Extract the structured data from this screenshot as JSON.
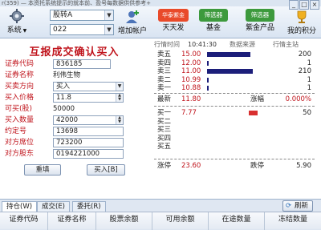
{
  "topbar": {
    "text": "r(359) — 本资托系统提示的就本前、盈号每数据供供参考+"
  },
  "toolbar": {
    "system_label": "系统",
    "stock_name": "股转A",
    "account": "022",
    "add_account_label": "增加帐户",
    "promo1_badge": "华泰紫金",
    "promo1_label": "天天发",
    "promo2_badge": "筛选器",
    "promo2_label": "基金",
    "promo3_badge": "筛选器",
    "promo3_label": "紫金产品",
    "points_label": "我的积分"
  },
  "form": {
    "title": "互报成交确认买入",
    "fields": [
      {
        "label": "证券代码",
        "value": "836185"
      },
      {
        "label": "证券名称",
        "value": "利伟生物"
      },
      {
        "label": "买卖方向",
        "value": "买入"
      },
      {
        "label": "买入价格",
        "value": "11.8"
      },
      {
        "label": "可买(股)",
        "value": "50000"
      },
      {
        "label": "买入数量",
        "value": "42000"
      },
      {
        "label": "约定号",
        "value": "13698"
      },
      {
        "label": "对方席位",
        "value": "723200"
      },
      {
        "label": "对方股东",
        "value": "0194221000"
      }
    ],
    "reset_label": "重填",
    "buy_label": "买入[B]"
  },
  "quote": {
    "time_label": "行情时间",
    "time_value": "10:41:30",
    "source_label": "数据来源",
    "source_value": "行情主站",
    "asks": [
      {
        "name": "卖五",
        "price": "15.00",
        "volume": "200",
        "bar": 0.9
      },
      {
        "name": "卖四",
        "price": "12.00",
        "volume": "1",
        "bar": 0.02
      },
      {
        "name": "卖三",
        "price": "11.00",
        "volume": "210",
        "bar": 0.95
      },
      {
        "name": "卖二",
        "price": "10.99",
        "volume": "1",
        "bar": 0.02
      },
      {
        "name": "卖一",
        "price": "10.88",
        "volume": "1",
        "bar": 0.02
      }
    ],
    "latest_label": "最新",
    "latest_value": "11.80",
    "change_label": "涨幅",
    "change_value": "0.000%",
    "bids": [
      {
        "name": "买一",
        "price": "7.77",
        "volume": "50",
        "bar": 0.18
      },
      {
        "name": "买二",
        "price": "",
        "volume": ""
      },
      {
        "name": "买三",
        "price": "",
        "volume": ""
      },
      {
        "name": "买四",
        "price": "",
        "volume": ""
      },
      {
        "name": "买五",
        "price": "",
        "volume": ""
      }
    ],
    "limit_up_label": "涨停",
    "limit_up_value": "23.60",
    "limit_down_label": "跌停",
    "limit_down_value": "5.90"
  },
  "tabs": [
    {
      "label": "持仓(W)"
    },
    {
      "label": "成交(E)"
    },
    {
      "label": "委托(R)"
    }
  ],
  "refresh_label": "刷新",
  "grid_columns": [
    "证券代码",
    "证券名称",
    "股票余额",
    "可用余额",
    "在途数量",
    "冻结数量"
  ],
  "colors": {
    "accent_red": "#c0141c",
    "bar_blue": "#1c1e7a",
    "bid_bar_red": "#d83030"
  }
}
